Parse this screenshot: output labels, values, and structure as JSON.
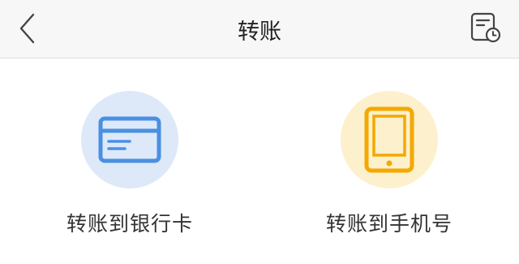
{
  "header": {
    "title": "转账",
    "back_icon": "chevron-left-icon",
    "history_icon": "transfer-history-icon"
  },
  "options": [
    {
      "label": "转账到银行卡",
      "icon": "bank-card-icon",
      "accent": "#4a90e2",
      "circle_bg": "#dde9f8"
    },
    {
      "label": "转账到手机号",
      "icon": "mobile-phone-icon",
      "accent": "#f5a800",
      "circle_bg": "#fdf0cc"
    }
  ]
}
